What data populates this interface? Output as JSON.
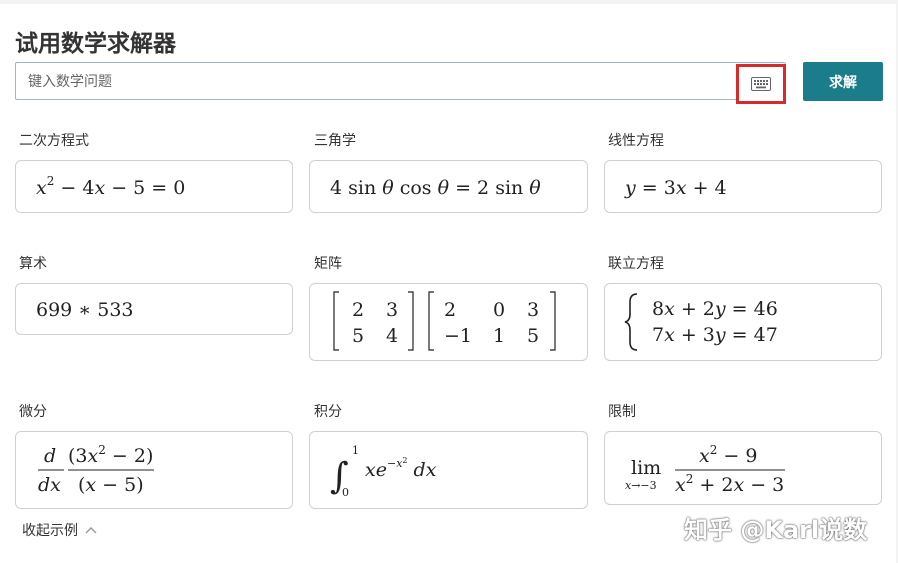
{
  "title": "试用数学求解器",
  "search": {
    "placeholder": "键入数学问题",
    "value": ""
  },
  "keyboard_icon": "keyboard-icon",
  "solve_label": "求解",
  "highlight_color": "#d52b2b",
  "accent_color": "#1b7c8b",
  "examples": [
    {
      "category": "二次方程式",
      "expression": "x^2 - 4x - 5 = 0"
    },
    {
      "category": "三角学",
      "expression": "4 sin θ cos θ = 2 sin θ"
    },
    {
      "category": "线性方程",
      "expression": "y = 3x + 4"
    },
    {
      "category": "算术",
      "expression": "699 * 533"
    },
    {
      "category": "矩阵",
      "expression": "[2 3; 5 4][2 0 3; -1 1 5]"
    },
    {
      "category": "联立方程",
      "expression": "{8x + 2y = 46; 7x + 3y = 47}"
    },
    {
      "category": "微分",
      "expression": "d/dx (3x^2 - 2)/(x - 5)"
    },
    {
      "category": "积分",
      "expression": "∫_0^1 x e^(-x^2) dx"
    },
    {
      "category": "限制",
      "expression": "lim_(x→-3) (x^2 - 9)/(x^2 + 2x - 3)"
    }
  ],
  "collapse_label": "收起示例",
  "watermark": "知乎 @Karl说数"
}
